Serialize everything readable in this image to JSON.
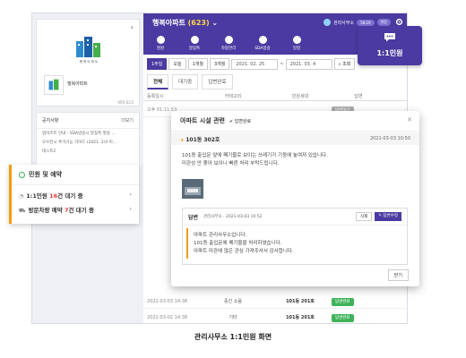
{
  "app": {
    "title": "행복아파트",
    "count": "(623)",
    "user_name": "관리사무소",
    "user_pill1": "58:29",
    "user_pill2": "연장"
  },
  "iconbar": [
    "명원",
    "알림톡",
    "차량관리",
    "SDA방송",
    "일정"
  ],
  "left": {
    "apt_name": "행복아파트",
    "apt_count": "세대 623",
    "logo_text": "행 복 아 파 트",
    "notice_title": "공지사항",
    "notice_more": "더보기",
    "notice_rows": [
      "업어즈트 안내 - SDA방송시 말침특 발송 ...",
      "오우전시 추가기능 가이드 (2021. 2/4 미...",
      "테스트2"
    ]
  },
  "filters": {
    "buttons": [
      "1주일",
      "오늘",
      "1개월",
      "3개월"
    ],
    "date_from": "2021. 02. 25",
    "date_to": "2021. 03. 4",
    "search": "조회"
  },
  "tabs": [
    "전체",
    "대기중",
    "답변완료"
  ],
  "table": {
    "headers": [
      "등록일시",
      "카테고리",
      "민원세대",
      "답변"
    ],
    "rows": [
      {
        "date": "오후 01:11:53",
        "cat": "",
        "unit": "",
        "status": "답변대기",
        "gray": true
      },
      {
        "date": "2021-03-03 14:38",
        "cat": "중간 소음",
        "unit": "101동 201호",
        "status": "답변완료",
        "gray": false
      },
      {
        "date": "2021-03-02 14:38",
        "cat": "기타",
        "unit": "101동 201호",
        "status": "답변완료",
        "gray": false
      }
    ]
  },
  "minwon_badge": "1:1민원",
  "popup_left": {
    "title": "민원 및 예약",
    "row1_prefix": "1:1민원 ",
    "row1_num": "16",
    "row1_suffix": "건 대기 중",
    "row2_prefix": "방문차량 예약 ",
    "row2_num": "7",
    "row2_suffix": "건 대기 중"
  },
  "modal": {
    "title": "아파트 시설 관련",
    "check": "답변완료",
    "dong": "101동 302호",
    "datetime": "2021-03-03 10:50",
    "body1": "101동 출입문 앞에 폐기물로 보이는 쓰레기가 기둥에 놓여져 있습니다.",
    "body2": "미관상 안 좋아 보이니 빠른 처리 부탁드립니다.",
    "answer_label": "답변",
    "answer_meta": "관리사무소 · 2021-03-03 10:52",
    "delete": "삭제",
    "edit": "답변수정",
    "answer1": "아파트 관리사무소입니다.",
    "answer2": "101동 출입문에 폐기물을 처리하였습니다.",
    "answer3": "아파트 미관에 많은 관심 가져주셔서 감사합니다.",
    "close": "닫기"
  },
  "caption": "관리사무소 1:1민원 화면",
  "colors": {
    "primary": "#4b3aa1",
    "accent": "#f39c12",
    "success": "#3eb35a",
    "danger": "#e53935"
  }
}
